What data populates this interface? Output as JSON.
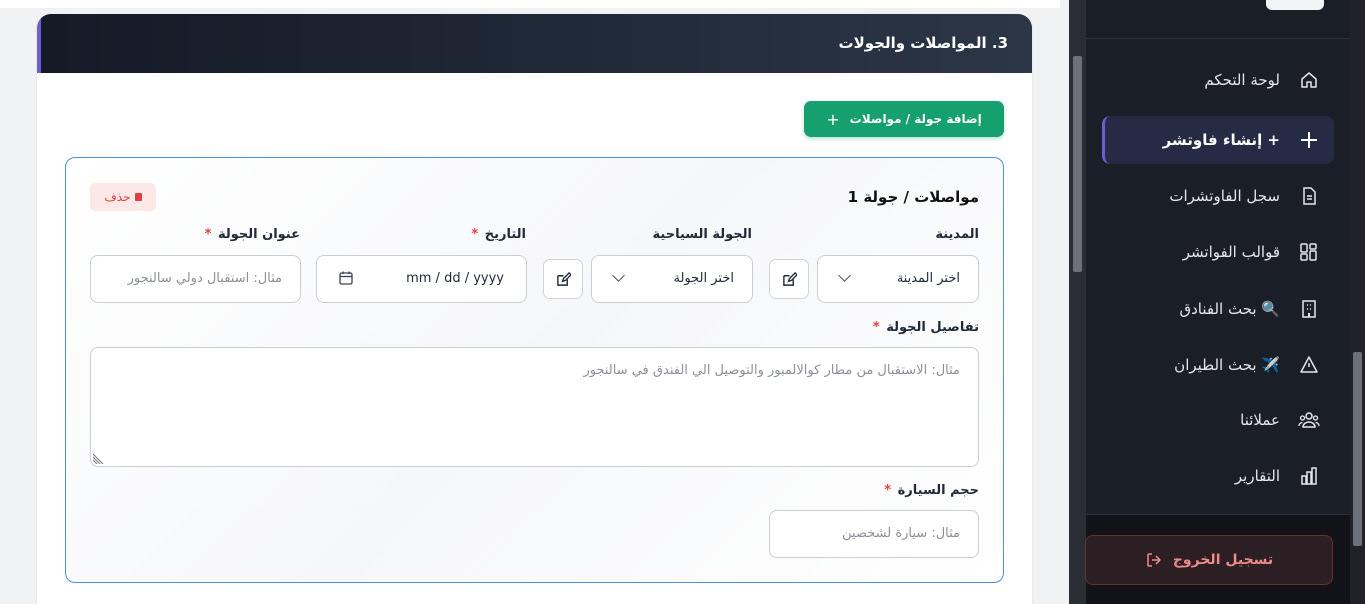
{
  "section": {
    "title": "3. المواصلات والجولات",
    "add_button": "إضافة جولة / مواصلات"
  },
  "tour": {
    "title": "مواصلات / جولة 1",
    "delete_label": "حذف",
    "city_label": "المدينة",
    "city_value": "اختر المدينة",
    "tourist_tour_label": "الجولة السياحية",
    "tourist_tour_value": "اختر الجولة",
    "date_label": "التاريخ",
    "date_placeholder": "mm / dd / yyyy",
    "tour_title_label": "عنوان الجولة",
    "tour_title_placeholder": "مثال: استقبال دولي سالنجور",
    "details_label": "تفاصيل الجولة",
    "details_placeholder": "مثال: الاستقبال من مطار كوالالمبور والتوصيل الي الفندق في سالنجور",
    "car_size_label": "حجم السيارة",
    "car_size_placeholder": "مثال: سيارة لشخصين",
    "required_mark": "*"
  },
  "sidebar": {
    "items": [
      {
        "label": "لوحة التحكم",
        "icon": "home-icon"
      },
      {
        "label": "+ إنشاء فاوتشر",
        "icon": "plus-icon",
        "active": true
      },
      {
        "label": "سجل الفاوتشرات",
        "icon": "document-icon"
      },
      {
        "label": "قوالب الفواتشر",
        "icon": "grid-icon"
      },
      {
        "label": "🔍 بحث الفنادق",
        "icon": "building-icon"
      },
      {
        "label": "✈️ بحث الطيران",
        "icon": "warning-icon"
      },
      {
        "label": "عملائنا",
        "icon": "users-icon"
      },
      {
        "label": "التقارير",
        "icon": "chart-icon"
      }
    ],
    "logout": "تسجيل الخروج"
  },
  "colors": {
    "accent": "#6d5dd3",
    "success": "#16a06f",
    "danger": "#e53e3e",
    "sidebar_bg": "#1a1e26"
  }
}
